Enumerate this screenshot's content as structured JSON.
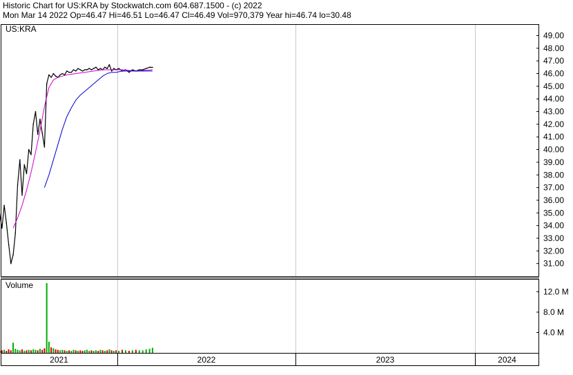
{
  "header": {
    "line1": "Historic Chart for US:KRA by Stockwatch.com 604.687.1500 - (c) 2022",
    "line2": "Mon Mar 14 2022   Op=46.47   Hi=46.51   Lo=46.47   Cl=46.49   Vol=970,379   Year hi=46.74   lo=30.48"
  },
  "colors": {
    "price": "#000000",
    "ma_short": "#cc00cc",
    "ma_long": "#0000cc",
    "volume_up": "#00aa00",
    "volume_down": "#cc0000",
    "grid": "#c8c8c8",
    "frame": "#000000"
  },
  "chart_data": [
    {
      "type": "line",
      "symbol_label": "US:KRA",
      "x_labels": [
        "2021",
        "2022",
        "2023",
        "2024"
      ],
      "y_ticks": [
        "49.00",
        "48.00",
        "47.00",
        "46.00",
        "45.00",
        "44.00",
        "43.00",
        "42.00",
        "41.00",
        "40.00",
        "39.00",
        "38.00",
        "37.00",
        "36.00",
        "35.00",
        "34.00",
        "33.00",
        "32.00",
        "31.00"
      ],
      "ylim": [
        30.0,
        49.9
      ],
      "grid": true,
      "series": [
        {
          "role": "price",
          "x": [
            "2020-12-01",
            "2020-12-08",
            "2020-12-15",
            "2020-12-22",
            "2020-12-29",
            "2021-01-05",
            "2021-01-12",
            "2021-01-19",
            "2021-01-26",
            "2021-02-02",
            "2021-02-09",
            "2021-02-16",
            "2021-02-23",
            "2021-03-02",
            "2021-03-09",
            "2021-03-16",
            "2021-03-23",
            "2021-03-30",
            "2021-04-06",
            "2021-04-13",
            "2021-04-20",
            "2021-04-27",
            "2021-05-04",
            "2021-05-11",
            "2021-05-18",
            "2021-05-25",
            "2021-06-01",
            "2021-06-08",
            "2021-06-15",
            "2021-06-22",
            "2021-06-29",
            "2021-07-06",
            "2021-07-13",
            "2021-07-20",
            "2021-07-27",
            "2021-08-03",
            "2021-08-10",
            "2021-08-17",
            "2021-08-24",
            "2021-08-31",
            "2021-09-07",
            "2021-09-14",
            "2021-09-21",
            "2021-09-28",
            "2021-10-05",
            "2021-10-12",
            "2021-10-19",
            "2021-10-26",
            "2021-11-02",
            "2021-11-09",
            "2021-11-16",
            "2021-11-23",
            "2021-11-30",
            "2021-12-07",
            "2021-12-14",
            "2021-12-21",
            "2021-12-28",
            "2022-01-04",
            "2022-01-11",
            "2022-01-18",
            "2022-01-25",
            "2022-02-01",
            "2022-02-08",
            "2022-02-15",
            "2022-02-22",
            "2022-03-01",
            "2022-03-08",
            "2022-03-14"
          ],
          "values": [
            36.2,
            35.6,
            34.8,
            35.2,
            34.9,
            33.8,
            35.6,
            34.2,
            32.5,
            31.0,
            31.7,
            33.4,
            37.2,
            39.2,
            36.4,
            38.8,
            38.1,
            40.0,
            39.6,
            42.0,
            43.0,
            41.2,
            42.4,
            41.3,
            40.2,
            45.2,
            45.9,
            45.7,
            46.0,
            45.8,
            45.7,
            45.9,
            46.0,
            45.9,
            46.2,
            46.1,
            46.1,
            46.3,
            46.2,
            46.4,
            46.3,
            46.2,
            46.3,
            46.3,
            46.4,
            46.3,
            46.4,
            46.5,
            46.3,
            46.4,
            46.3,
            46.5,
            46.4,
            46.7,
            46.2,
            46.4,
            46.3,
            46.4,
            46.2,
            46.3,
            46.1,
            46.3,
            46.2,
            46.3,
            46.3,
            46.4,
            46.5,
            46.49
          ]
        },
        {
          "role": "moving-average-short",
          "x": [
            "2021-02-09",
            "2021-02-23",
            "2021-03-09",
            "2021-03-23",
            "2021-04-06",
            "2021-04-20",
            "2021-05-04",
            "2021-05-18",
            "2021-06-01",
            "2021-06-15",
            "2021-06-29",
            "2021-07-13",
            "2021-07-27",
            "2021-08-24",
            "2021-09-21",
            "2021-10-19",
            "2021-11-16",
            "2021-12-14",
            "2022-01-11",
            "2022-02-08",
            "2022-03-14"
          ],
          "values": [
            33.8,
            34.6,
            35.6,
            36.8,
            38.2,
            39.8,
            41.5,
            43.4,
            44.9,
            45.5,
            45.7,
            45.8,
            45.9,
            46.0,
            46.1,
            46.2,
            46.3,
            46.3,
            46.3,
            46.2,
            46.3
          ]
        },
        {
          "role": "moving-average-long",
          "x": [
            "2021-05-18",
            "2021-06-01",
            "2021-06-15",
            "2021-06-29",
            "2021-07-13",
            "2021-07-27",
            "2021-08-10",
            "2021-08-24",
            "2021-09-07",
            "2021-09-21",
            "2021-10-05",
            "2021-10-19",
            "2021-11-02",
            "2021-11-16",
            "2021-11-30",
            "2021-12-14",
            "2021-12-28",
            "2022-01-11",
            "2022-01-25",
            "2022-02-08",
            "2022-02-22",
            "2022-03-14"
          ],
          "values": [
            37.0,
            38.0,
            39.2,
            40.4,
            41.6,
            42.6,
            43.3,
            43.9,
            44.3,
            44.6,
            44.9,
            45.2,
            45.5,
            45.8,
            46.0,
            46.1,
            46.1,
            46.2,
            46.2,
            46.2,
            46.2,
            46.2
          ]
        }
      ]
    },
    {
      "type": "bar",
      "title": "Volume",
      "x_labels": [
        "2021",
        "2022",
        "2023",
        "2024"
      ],
      "y_ticks": [
        "12.0 M",
        "8.0 M",
        "4.0 M"
      ],
      "ylim": [
        0,
        14.5
      ],
      "grid": true,
      "unit": "M",
      "categories": [
        "2020-12-01",
        "2020-12-08",
        "2020-12-15",
        "2020-12-22",
        "2020-12-29",
        "2021-01-05",
        "2021-01-12",
        "2021-01-19",
        "2021-01-26",
        "2021-02-02",
        "2021-02-09",
        "2021-02-16",
        "2021-02-23",
        "2021-03-02",
        "2021-03-09",
        "2021-03-16",
        "2021-03-23",
        "2021-03-30",
        "2021-04-06",
        "2021-04-13",
        "2021-04-20",
        "2021-04-27",
        "2021-05-04",
        "2021-05-11",
        "2021-05-18",
        "2021-05-25",
        "2021-06-01",
        "2021-06-08",
        "2021-06-15",
        "2021-06-22",
        "2021-06-29",
        "2021-07-06",
        "2021-07-13",
        "2021-07-20",
        "2021-07-27",
        "2021-08-03",
        "2021-08-10",
        "2021-08-17",
        "2021-08-24",
        "2021-08-31",
        "2021-09-07",
        "2021-09-14",
        "2021-09-21",
        "2021-09-28",
        "2021-10-05",
        "2021-10-12",
        "2021-10-19",
        "2021-10-26",
        "2021-11-02",
        "2021-11-09",
        "2021-11-16",
        "2021-11-23",
        "2021-11-30",
        "2021-12-07",
        "2021-12-14",
        "2021-12-21",
        "2021-12-28",
        "2022-01-04",
        "2022-01-11",
        "2022-01-18",
        "2022-01-25",
        "2022-02-01",
        "2022-02-08",
        "2022-02-15",
        "2022-02-22",
        "2022-03-01",
        "2022-03-08",
        "2022-03-14"
      ],
      "values": [
        0.5,
        0.4,
        0.6,
        0.5,
        0.4,
        0.5,
        0.6,
        0.4,
        0.7,
        0.5,
        2.0,
        0.8,
        0.6,
        0.5,
        0.7,
        0.4,
        0.5,
        0.6,
        0.5,
        0.7,
        0.6,
        0.5,
        0.8,
        0.6,
        0.9,
        13.7,
        2.2,
        1.1,
        0.9,
        0.7,
        0.6,
        0.5,
        0.6,
        0.5,
        0.4,
        0.5,
        0.4,
        0.6,
        0.5,
        0.4,
        0.5,
        0.4,
        0.5,
        0.6,
        0.4,
        0.5,
        0.4,
        0.5,
        0.4,
        0.6,
        0.5,
        0.4,
        0.5,
        0.7,
        0.5,
        0.4,
        0.5,
        0.4,
        0.6,
        0.5,
        0.4,
        0.5,
        0.6,
        0.5,
        0.5,
        0.7,
        0.8,
        1.0
      ],
      "direction": [
        "up",
        "down",
        "down",
        "up",
        "down",
        "down",
        "up",
        "down",
        "down",
        "down",
        "up",
        "up",
        "up",
        "up",
        "down",
        "up",
        "down",
        "up",
        "down",
        "up",
        "up",
        "down",
        "up",
        "down",
        "down",
        "up",
        "up",
        "down",
        "up",
        "down",
        "down",
        "up",
        "up",
        "down",
        "up",
        "down",
        "up",
        "up",
        "down",
        "up",
        "down",
        "down",
        "up",
        "up",
        "up",
        "down",
        "up",
        "up",
        "down",
        "up",
        "down",
        "up",
        "down",
        "up",
        "down",
        "up",
        "down",
        "up",
        "down",
        "up",
        "down",
        "up",
        "down",
        "up",
        "up",
        "up",
        "up",
        "up"
      ]
    }
  ]
}
